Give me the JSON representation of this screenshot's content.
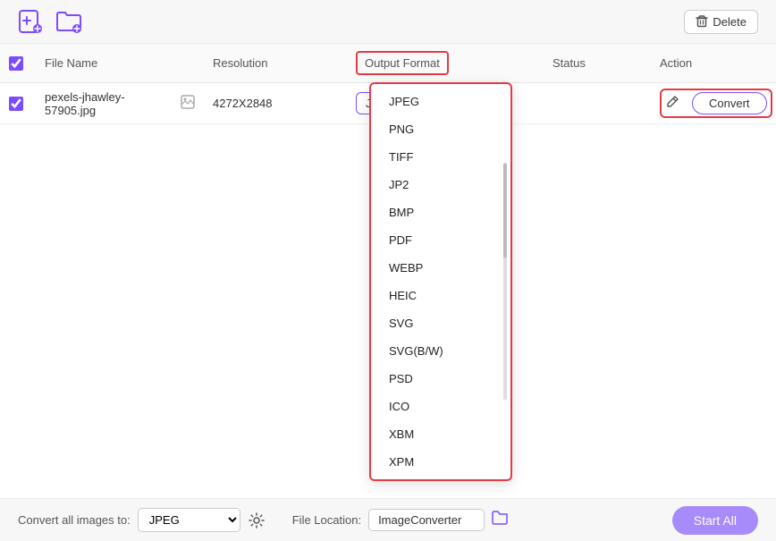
{
  "toolbar": {
    "add_file_label": "Add File",
    "add_folder_label": "Add Folder",
    "delete_label": "Delete"
  },
  "table": {
    "headers": {
      "checkbox": "",
      "file_name": "File Name",
      "resolution": "Resolution",
      "output_format": "Output Format",
      "status": "Status",
      "action": "Action"
    },
    "rows": [
      {
        "checked": true,
        "file_name": "pexels-jhawley-57905.jpg",
        "resolution": "4272X2848",
        "output_format": "JPEG",
        "status": "",
        "action_edit": "",
        "action_convert": "Convert"
      }
    ]
  },
  "dropdown_menu": {
    "items": [
      "JPEG",
      "PNG",
      "TIFF",
      "JP2",
      "BMP",
      "PDF",
      "WEBP",
      "HEIC",
      "SVG",
      "SVG(B/W)",
      "PSD",
      "ICO",
      "XBM",
      "XPM"
    ]
  },
  "bottom_bar": {
    "convert_all_label": "Convert all images to:",
    "convert_all_value": "JPEG",
    "file_location_label": "File Location:",
    "file_location_value": "ImageConverter",
    "start_all_label": "Start All"
  }
}
